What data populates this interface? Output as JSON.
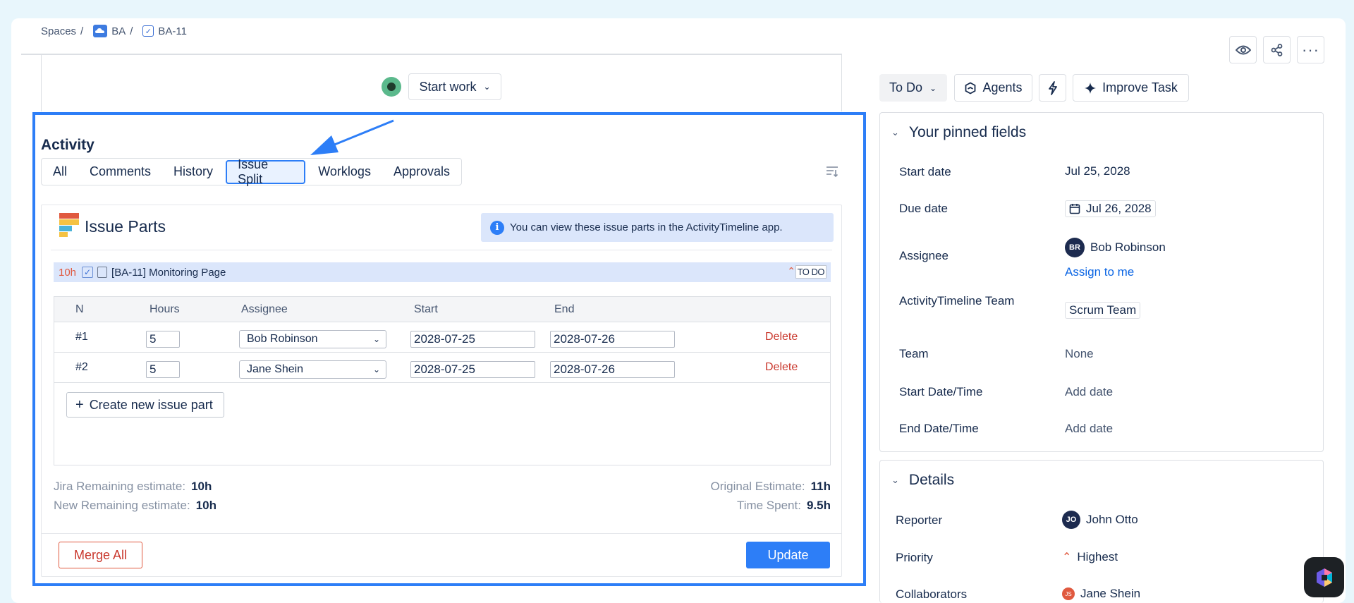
{
  "breadcrumb": {
    "spaces": "Spaces",
    "sep": "/",
    "project": "BA",
    "issue": "BA-11"
  },
  "header": {
    "start_work": "Start work",
    "status": "To Do",
    "agents": "Agents",
    "improve": "Improve Task"
  },
  "activity": {
    "title": "Activity",
    "tabs": [
      "All",
      "Comments",
      "History",
      "Issue Split",
      "Worklogs",
      "Approvals"
    ],
    "active_tab": "Issue Split"
  },
  "issue_parts": {
    "title": "Issue Parts",
    "info": "You can view these issue parts in the ActivityTimeline app.",
    "issue": {
      "estimate": "10h",
      "label": "[BA-11] Monitoring Page",
      "status": "TO DO"
    },
    "columns": [
      "N",
      "Hours",
      "Assignee",
      "Start",
      "End"
    ],
    "rows": [
      {
        "n": "#1",
        "hours": "5",
        "assignee": "Bob Robinson",
        "start": "2028-07-25",
        "end": "2028-07-26",
        "action": "Delete"
      },
      {
        "n": "#2",
        "hours": "5",
        "assignee": "Jane Shein",
        "start": "2028-07-25",
        "end": "2028-07-26",
        "action": "Delete"
      }
    ],
    "create": "Create new issue part",
    "jira_remaining_label": "Jira Remaining estimate:",
    "jira_remaining": "10h",
    "new_remaining_label": "New Remaining estimate:",
    "new_remaining": "10h",
    "original_label": "Original Estimate:",
    "original": "11h",
    "spent_label": "Time Spent:",
    "spent": "9.5h",
    "merge": "Merge All",
    "update": "Update"
  },
  "pinned": {
    "title": "Your pinned fields",
    "start_date_label": "Start date",
    "start_date": "Jul 25, 2028",
    "due_date_label": "Due date",
    "due_date": "Jul 26, 2028",
    "assignee_label": "Assignee",
    "assignee_initials": "BR",
    "assignee": "Bob Robinson",
    "assign_to_me": "Assign to me",
    "at_team_label": "ActivityTimeline Team",
    "at_team": "Scrum Team",
    "team_label": "Team",
    "team": "None",
    "start_dt_label": "Start Date/Time",
    "start_dt": "Add date",
    "end_dt_label": "End Date/Time",
    "end_dt": "Add date"
  },
  "details": {
    "title": "Details",
    "reporter_label": "Reporter",
    "reporter_initials": "JO",
    "reporter": "John Otto",
    "priority_label": "Priority",
    "priority": "Highest",
    "collaborators_label": "Collaborators",
    "collaborator_initials": "JS",
    "collaborator": "Jane Shein"
  },
  "colors": {
    "accent": "#2d7ef7",
    "danger": "#c9372c",
    "priority": "#e0593f"
  }
}
